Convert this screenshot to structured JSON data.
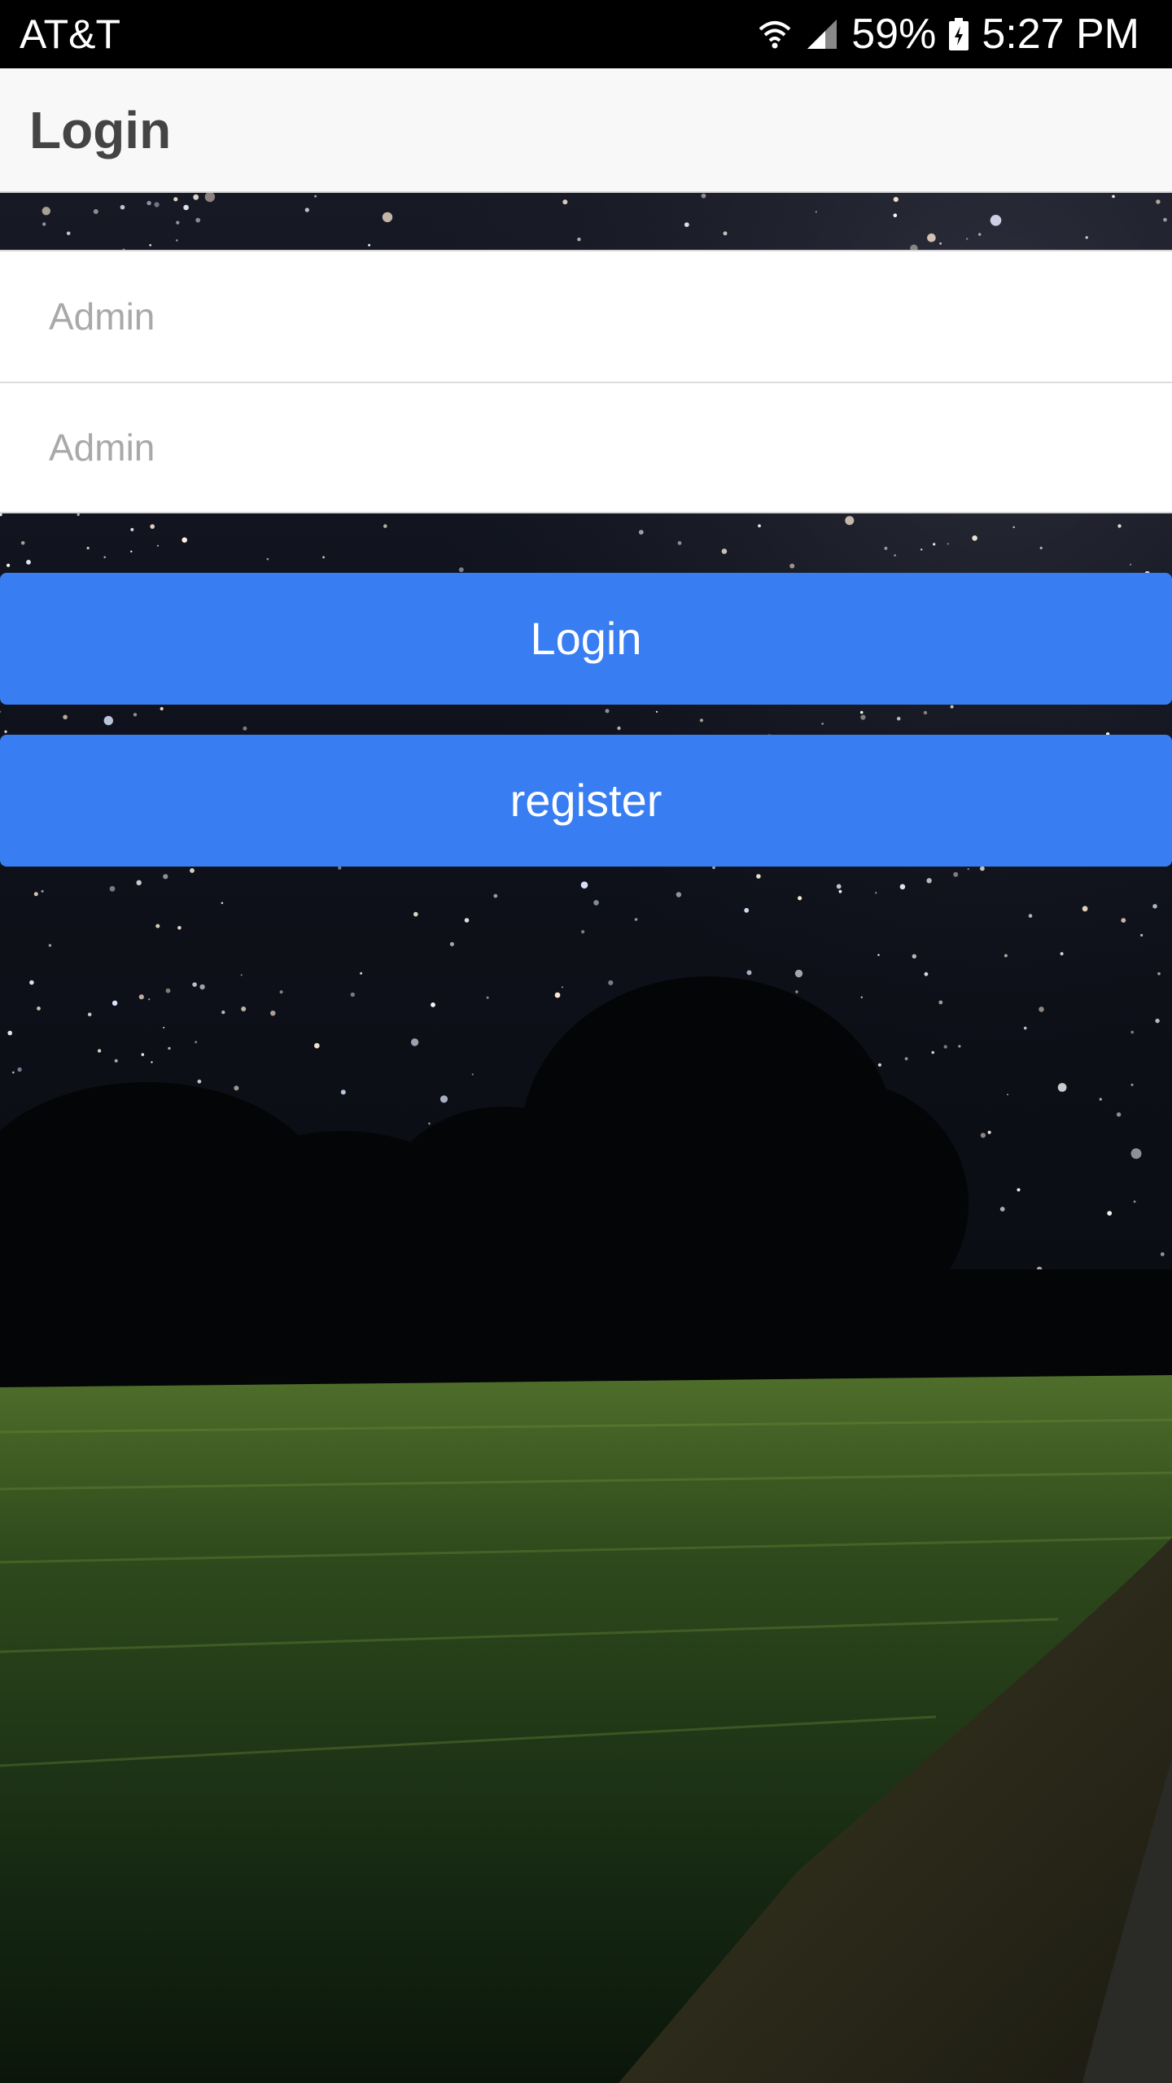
{
  "status_bar": {
    "carrier": "AT&T",
    "battery_percent": "59%",
    "time": "5:27 PM",
    "icons": [
      "wifi-icon",
      "cell-signal-icon",
      "battery-charging-icon"
    ]
  },
  "app_bar": {
    "title": "Login"
  },
  "form": {
    "username_placeholder": "Admin",
    "password_placeholder": "Admin",
    "login_label": "Login",
    "register_label": "register"
  },
  "colors": {
    "primary": "#387ef2",
    "app_bar_bg": "#f8f8f8",
    "status_bar_bg": "#000000",
    "title_text": "#444444",
    "placeholder": "#a9a9a9"
  },
  "background": {
    "description_icon": "night-sky-field-image"
  }
}
